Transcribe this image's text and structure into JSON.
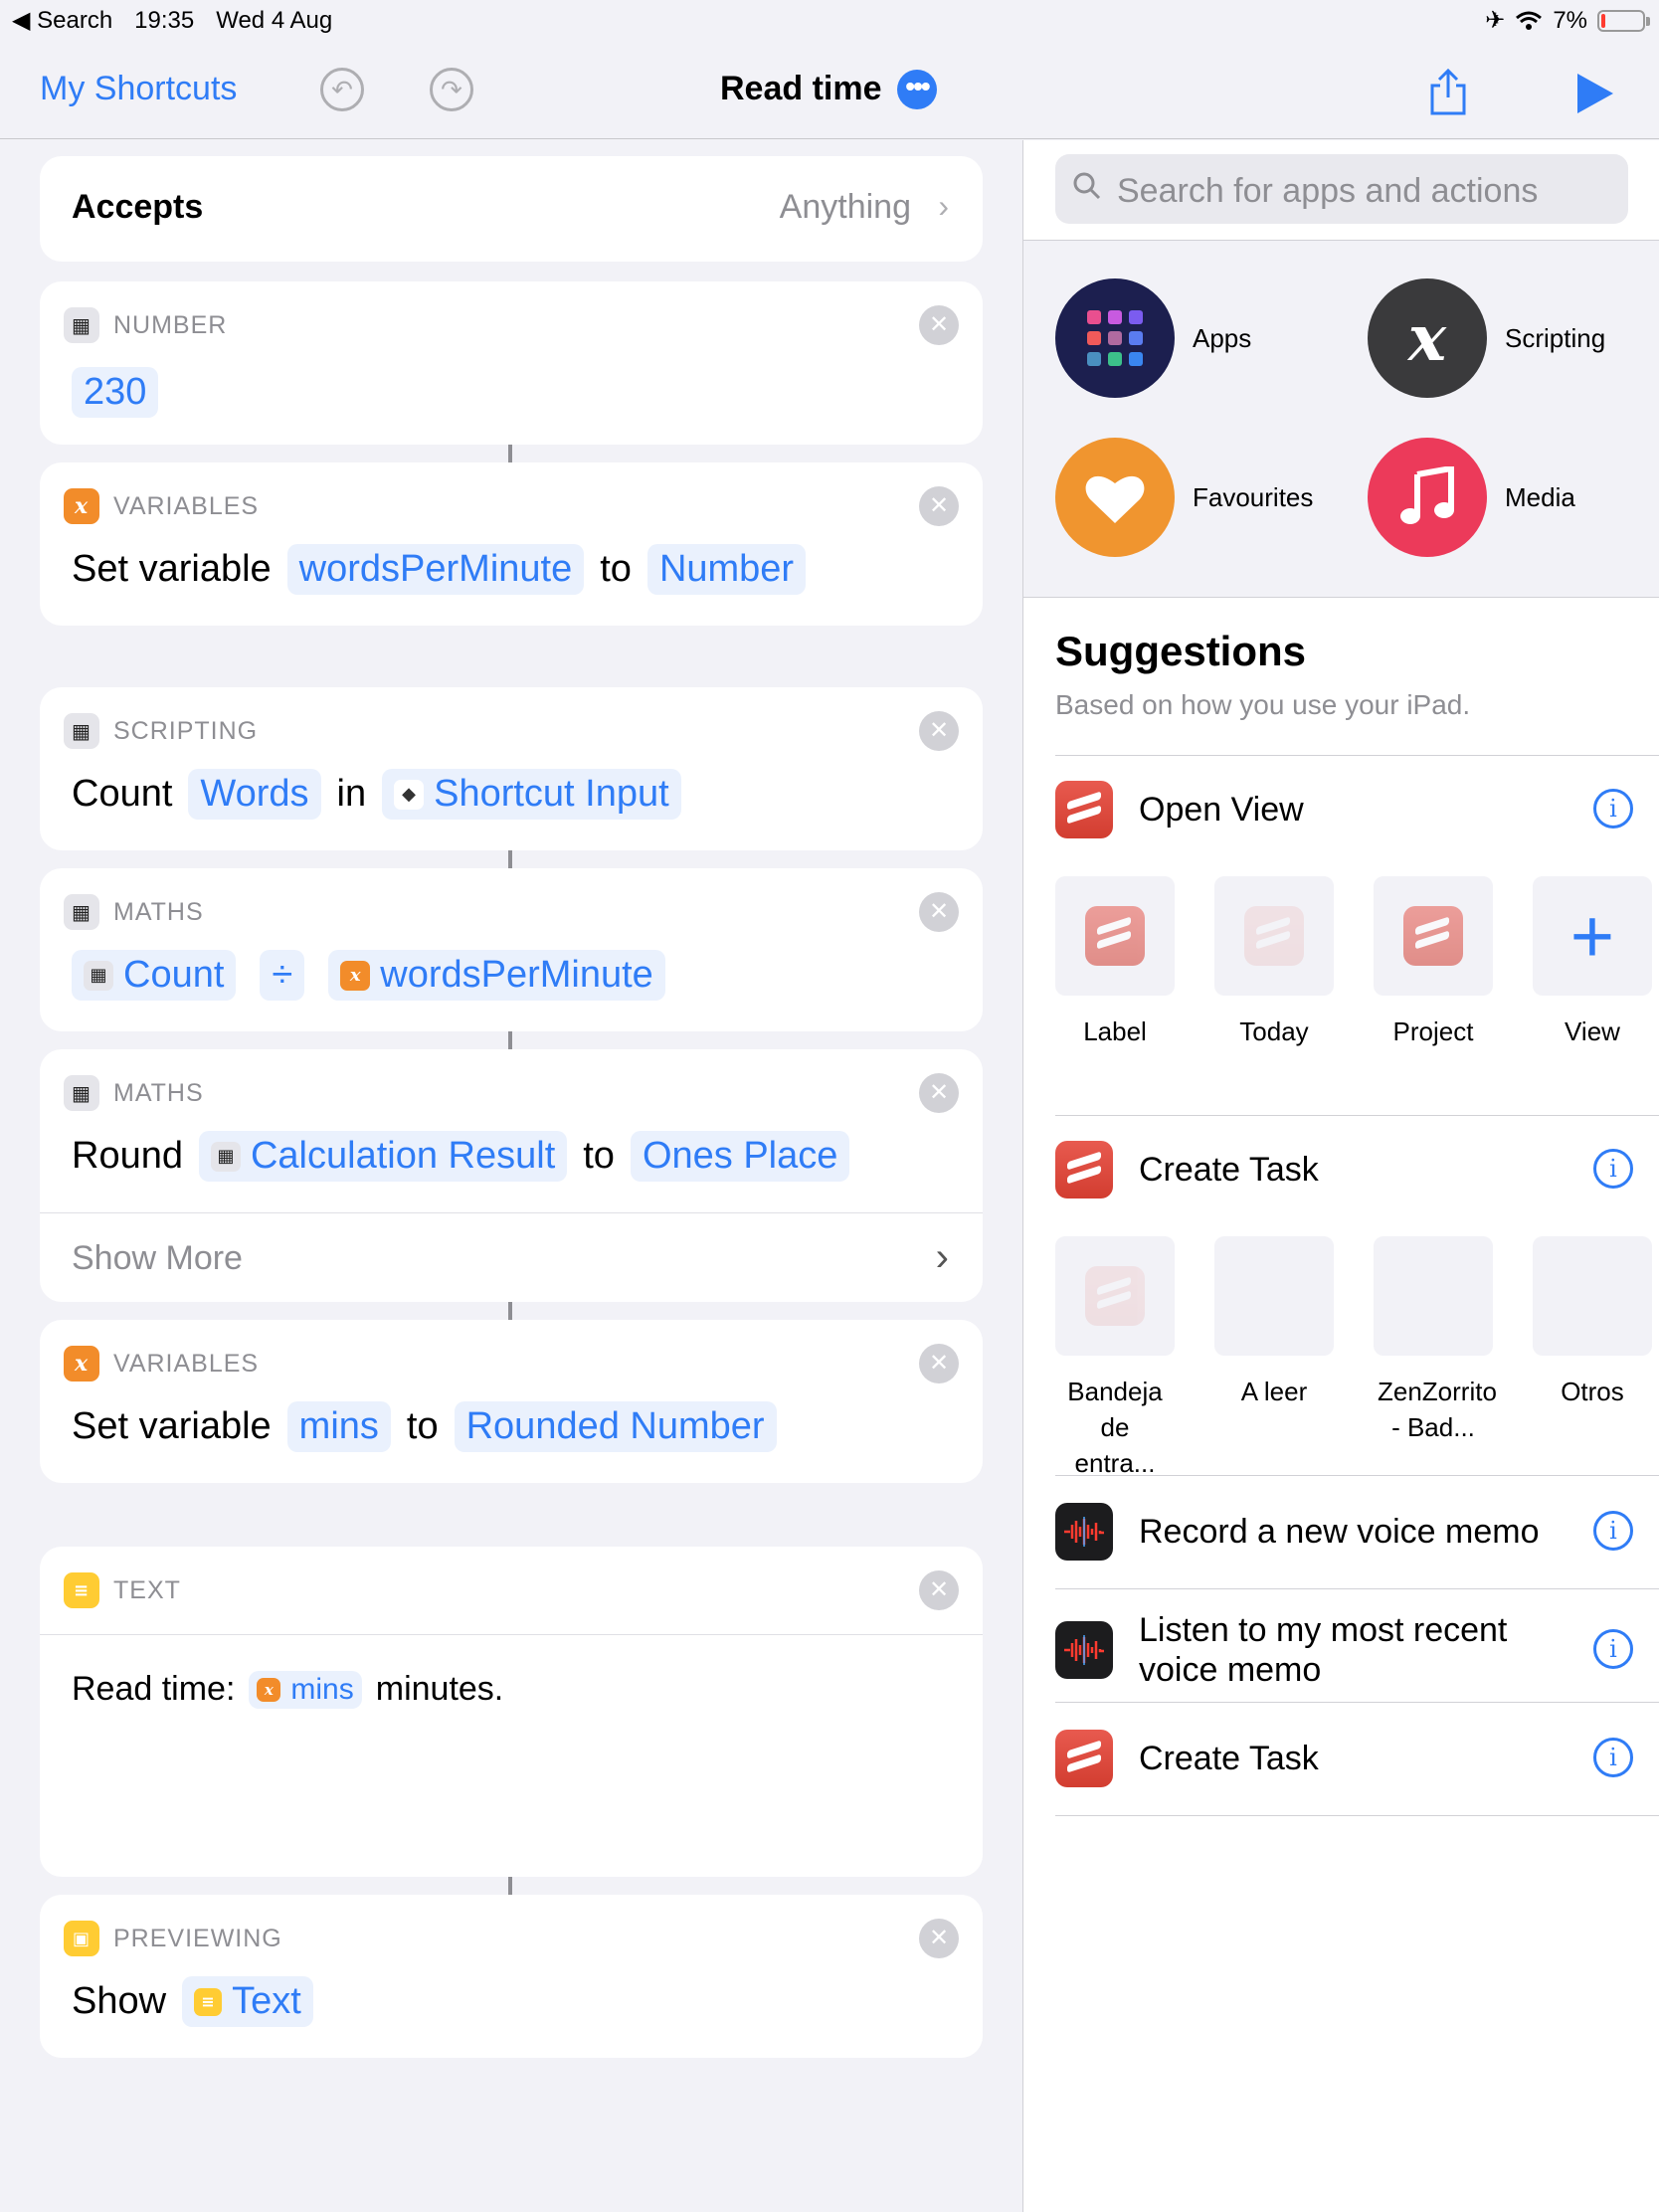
{
  "status": {
    "back_app": "Search",
    "time": "19:35",
    "date": "Wed 4 Aug",
    "battery": "7%",
    "battery_level": 0.07
  },
  "nav": {
    "back_label": "My Shortcuts",
    "title": "Read time",
    "more_glyph": "•••"
  },
  "accepts": {
    "label": "Accepts",
    "value": "Anything"
  },
  "actions": {
    "number": {
      "category": "NUMBER",
      "value": "230"
    },
    "setvar1": {
      "category": "VARIABLES",
      "verb": "Set variable",
      "name": "wordsPerMinute",
      "to": "to",
      "value": "Number"
    },
    "count": {
      "category": "SCRIPTING",
      "verb": "Count",
      "what": "Words",
      "in": "in",
      "source": "Shortcut Input"
    },
    "maths": {
      "category": "MATHS",
      "left": "Count",
      "op": "÷",
      "right": "wordsPerMinute"
    },
    "round": {
      "category": "MATHS",
      "verb": "Round",
      "value": "Calculation Result",
      "to": "to",
      "place": "Ones Place",
      "show_more": "Show More"
    },
    "setvar2": {
      "category": "VARIABLES",
      "verb": "Set variable",
      "name": "mins",
      "to": "to",
      "value": "Rounded Number"
    },
    "text": {
      "category": "TEXT",
      "prefix": "Read time:",
      "var": "mins",
      "suffix": "minutes."
    },
    "show": {
      "category": "PREVIEWING",
      "verb": "Show",
      "value": "Text"
    }
  },
  "library": {
    "search_placeholder": "Search for apps and actions",
    "categories": [
      "Apps",
      "Scripting",
      "Favourites",
      "Media"
    ],
    "suggestions_title": "Suggestions",
    "suggestions_sub": "Based on how you use your iPad.",
    "open_view": {
      "title": "Open View",
      "tiles": [
        "Label",
        "Today",
        "Project",
        "View"
      ]
    },
    "create_task": {
      "title": "Create Task",
      "tiles": [
        "Bandeja de entra...",
        "A leer",
        "ZenZorrito - Bad...",
        "Otros"
      ]
    },
    "rows": [
      "Record a new voice memo",
      "Listen to my most recent voice memo",
      "Create Task"
    ]
  },
  "colors": {
    "accent": "#2f7cf6",
    "variables": "#f28c2a",
    "text_yellow": "#ffcc33",
    "todoist": "#db4035"
  }
}
